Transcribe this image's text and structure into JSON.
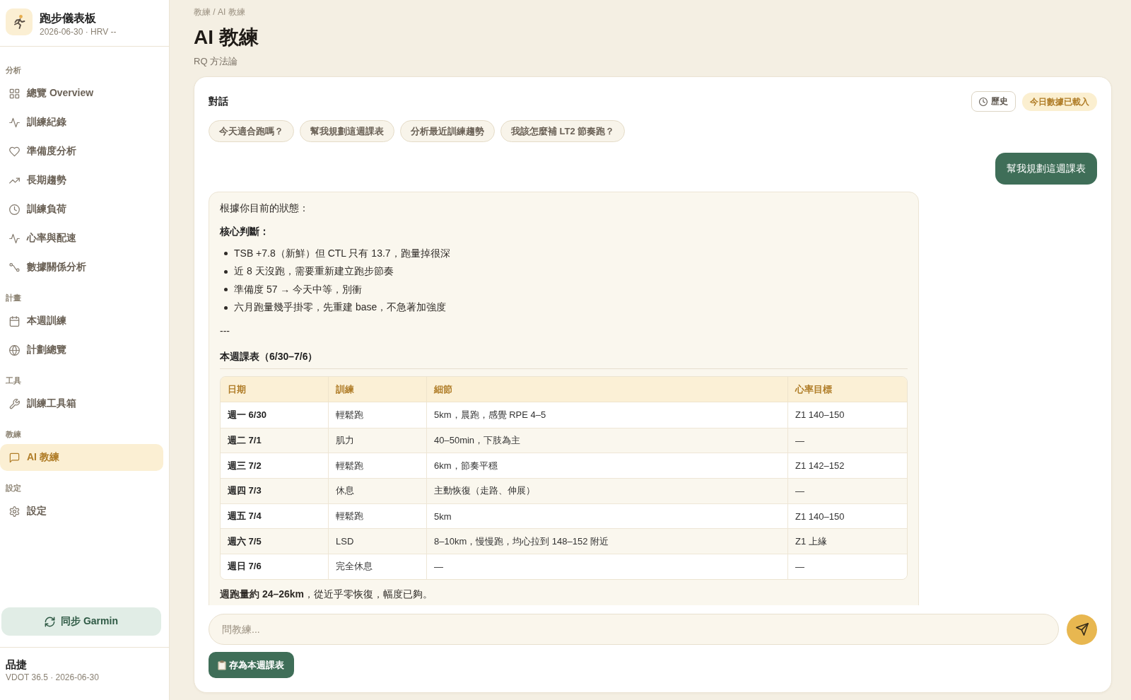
{
  "sidebar": {
    "app_title": "跑步儀表板",
    "app_subtitle": "2026-06-30 · HRV --",
    "sections": [
      {
        "label": "分析",
        "items": [
          {
            "label": "總覽 Overview",
            "selected": false
          },
          {
            "label": "訓練紀錄",
            "selected": false
          },
          {
            "label": "準備度分析",
            "selected": false
          },
          {
            "label": "長期趨勢",
            "selected": false
          },
          {
            "label": "訓練負荷",
            "selected": false
          },
          {
            "label": "心率與配速",
            "selected": false
          },
          {
            "label": "數據關係分析",
            "selected": false
          }
        ]
      },
      {
        "label": "計畫",
        "items": [
          {
            "label": "本週訓練",
            "selected": false
          },
          {
            "label": "計劃總覽",
            "selected": false
          }
        ]
      },
      {
        "label": "工具",
        "items": [
          {
            "label": "訓練工具箱",
            "selected": false
          }
        ]
      },
      {
        "label": "教練",
        "items": [
          {
            "label": "AI 教練",
            "selected": true
          }
        ]
      },
      {
        "label": "設定",
        "items": [
          {
            "label": "設定",
            "selected": false
          }
        ]
      }
    ],
    "sync_button": "同步 Garmin",
    "user": {
      "name": "品捷",
      "detail": "VDOT 36.5 · 2026-06-30"
    }
  },
  "header": {
    "breadcrumb": "教練 / AI 教練",
    "title": "AI 教練",
    "subtitle": "RQ 方法論"
  },
  "chat": {
    "title": "對話",
    "history_button": "歷史",
    "status_badge": "今日數據已載入",
    "suggestions": [
      "今天適合跑嗎？",
      "幫我規劃這週課表",
      "分析最近訓練趨勢",
      "我該怎麼補 LT2 節奏跑？"
    ],
    "messages": [
      {
        "kind": "user",
        "text": "幫我規劃這週課表"
      },
      {
        "kind": "assistant",
        "blocks": [
          {
            "kind": "paragraph",
            "text": "根據你目前的狀態："
          },
          {
            "kind": "label",
            "text": "核心判斷："
          },
          {
            "kind": "list",
            "items": [
              "TSB +7.8（新鮮）但 CTL 只有 13.7，跑量掉很深",
              "近 8 天沒跑，需要重新建立跑步節奏",
              "準備度 57 → 今天中等，別衝",
              "六月跑量幾乎掛零，先重建 base，不急著加強度"
            ]
          },
          {
            "kind": "paragraph",
            "text": "---"
          },
          {
            "kind": "heading",
            "text": "本週課表（6/30–7/6）"
          },
          {
            "kind": "table",
            "columns": [
              "日期",
              "訓練",
              "細節",
              "心率目標"
            ],
            "rows": [
              [
                "週一 6/30",
                "輕鬆跑",
                "5km，晨跑，感覺 RPE 4–5",
                "Z1 140–150"
              ],
              [
                "週二 7/1",
                "肌力",
                "40–50min，下肢為主",
                "—"
              ],
              [
                "週三 7/2",
                "輕鬆跑",
                "6km，節奏平穩",
                "Z1 142–152"
              ],
              [
                "週四 7/3",
                "休息",
                "主動恢復（走路、伸展）",
                "—"
              ],
              [
                "週五 7/4",
                "輕鬆跑",
                "5km",
                "Z1 140–150"
              ],
              [
                "週六 7/5",
                "LSD",
                "8–10km，慢慢跑，均心拉到 148–152 附近",
                "Z1 上緣"
              ],
              [
                "週日 7/6",
                "完全休息",
                "—",
                "—"
              ]
            ]
          },
          {
            "kind": "paragraph",
            "text": "**週跑量約 24–26km**，從近乎零恢復，幅度已夠。"
          }
        ]
      }
    ],
    "input": {
      "placeholder": "問教練..."
    },
    "save_button": "存為本週課表"
  }
}
